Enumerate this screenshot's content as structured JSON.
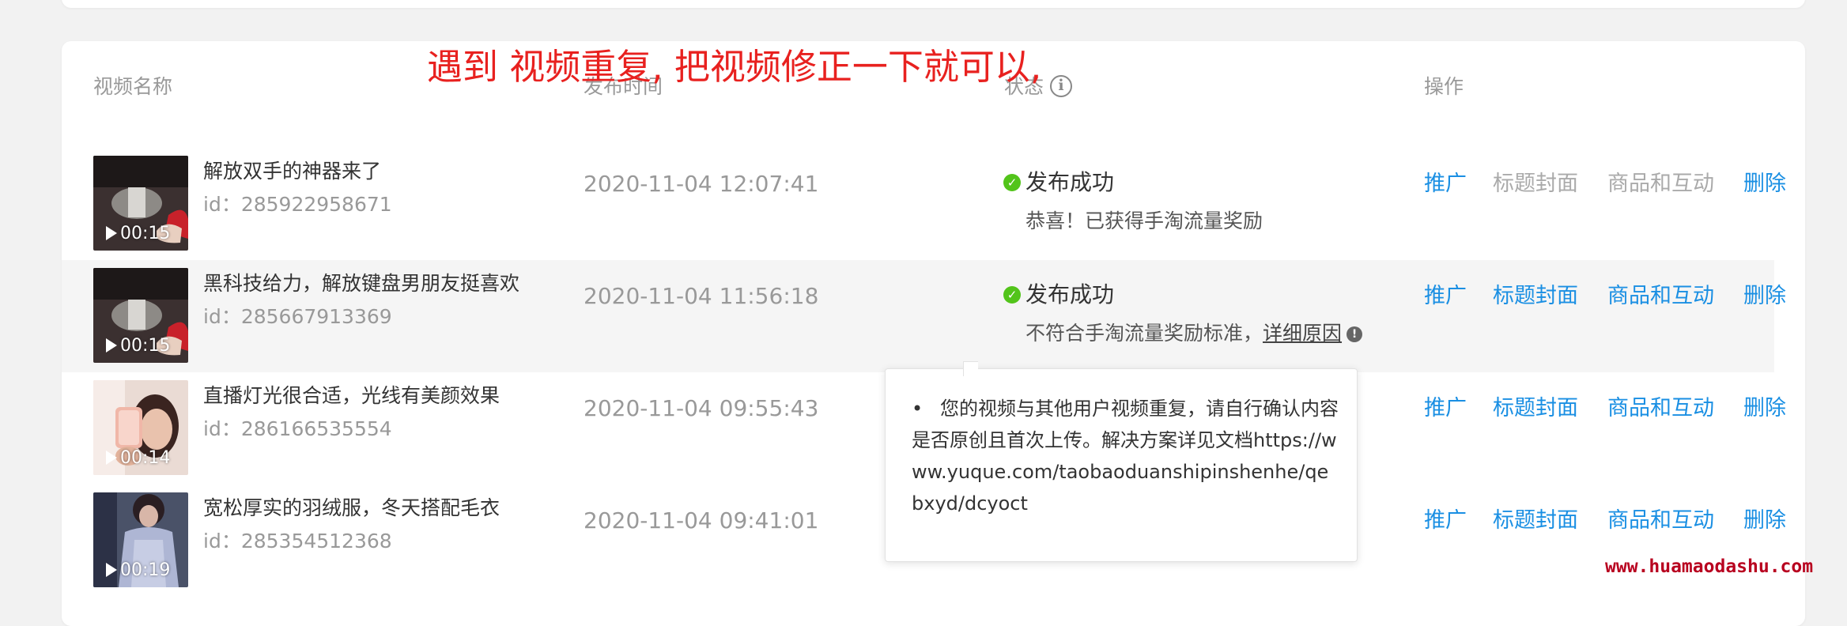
{
  "annotation": "遇到 视频重复, 把视频修正一下就可以,",
  "table": {
    "headers": {
      "name": "视频名称",
      "time": "发布时间",
      "status": "状态",
      "status_info": "i",
      "actions": "操作"
    },
    "rows": [
      {
        "title": "解放双手的神器来了",
        "id": "id：285922958671",
        "duration": "00:15",
        "time": "2020-11-04 12:07:41",
        "status": "发布成功",
        "sub": "恭喜！已获得手淘流量奖励",
        "actions": [
          "推广",
          "标题封面",
          "商品和互动",
          "删除"
        ]
      },
      {
        "title": "黑科技给力，解放键盘男朋友挺喜欢",
        "id": "id：285667913369",
        "duration": "00:15",
        "time": "2020-11-04 11:56:18",
        "status": "发布成功",
        "sub": "不符合手淘流量奖励标准，",
        "sub_link": "详细原因",
        "actions": [
          "推广",
          "标题封面",
          "商品和互动",
          "删除"
        ]
      },
      {
        "title": "直播灯光很合适，光线有美颜效果",
        "id": "id：286166535554",
        "duration": "00:14",
        "time": "2020-11-04 09:55:43",
        "actions": [
          "推广",
          "标题封面",
          "商品和互动",
          "删除"
        ]
      },
      {
        "title": "宽松厚实的羽绒服，冬天搭配毛衣",
        "id": "id：285354512368",
        "duration": "00:19",
        "time": "2020-11-04 09:41:01",
        "actions": [
          "推广",
          "标题封面",
          "商品和互动",
          "删除"
        ]
      }
    ]
  },
  "tooltip": {
    "bullet": "•",
    "text": "您的视频与其他用户视频重复，请自行确认内容是否原创且首次上传。解决方案详见文档https://www.yuque.com/taobaoduanshipinshenhe/qebxyd/dcyoct"
  },
  "watermark": "www.huamaodashu.com",
  "colors": {
    "link": "#1a8fe3",
    "disabled": "#aaaaaa",
    "success": "#52c41a",
    "annotation": "#e8211f",
    "watermark": "#b8001f"
  }
}
